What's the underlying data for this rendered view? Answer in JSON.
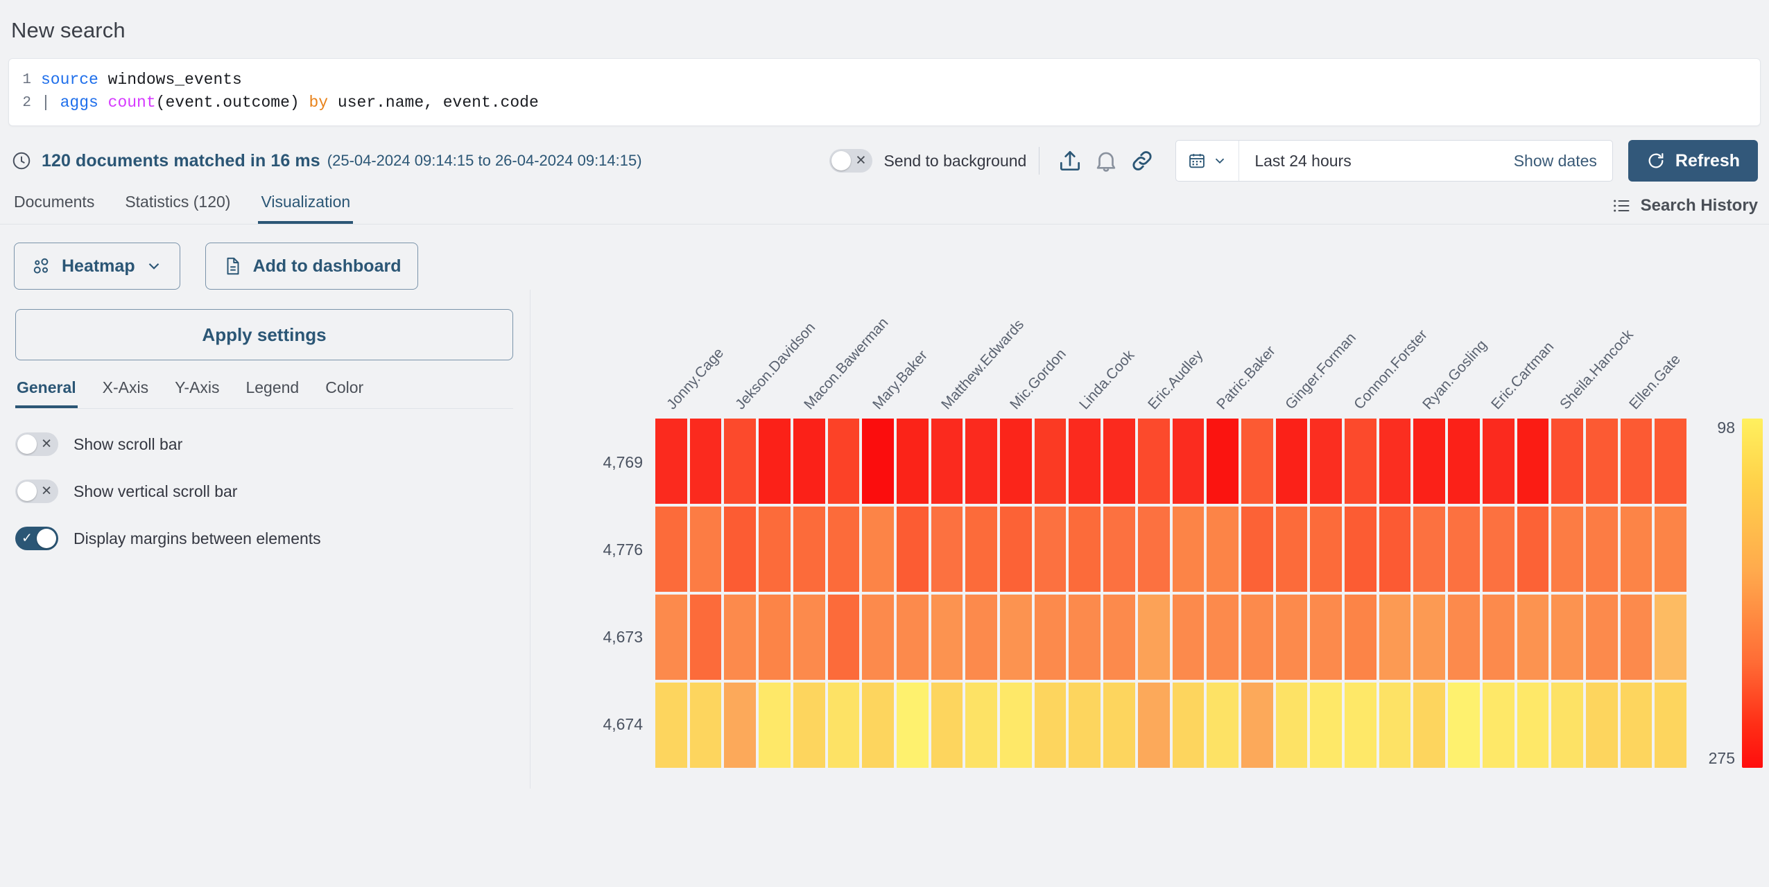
{
  "page": {
    "title": "New search"
  },
  "query": {
    "lines": [
      {
        "number": "1",
        "pipe": "",
        "tokens": [
          {
            "t": "source",
            "c": "kw"
          },
          {
            "t": " windows_events",
            "c": "txt"
          }
        ]
      },
      {
        "number": "2",
        "pipe": "|",
        "tokens": [
          {
            "t": " aggs ",
            "c": "kw"
          },
          {
            "t": "count",
            "c": "fn"
          },
          {
            "t": "(event.outcome) ",
            "c": "txt"
          },
          {
            "t": "by",
            "c": "op"
          },
          {
            "t": " user.name, event.code",
            "c": "txt"
          }
        ]
      }
    ]
  },
  "status": {
    "clock_icon": "clock-icon",
    "hits": "120 documents matched in 16 ms",
    "range": "(25-04-2024 09:14:15 to 26-04-2024 09:14:15)",
    "send_to_background": "Send to background",
    "send_to_background_state": "off",
    "export_icon": "export-icon",
    "alert_icon": "bell-icon",
    "link_icon": "link-icon",
    "calendar_icon": "calendar-icon",
    "chevron_icon": "chevron-down-icon",
    "date_range": "Last 24 hours",
    "show_dates": "Show dates",
    "refresh": "Refresh",
    "refresh_icon": "refresh-icon"
  },
  "tabs": {
    "items": [
      {
        "label": "Documents",
        "active": false
      },
      {
        "label": "Statistics (120)",
        "active": false
      },
      {
        "label": "Visualization",
        "active": true
      }
    ],
    "search_history": "Search History",
    "search_history_icon": "list-icon"
  },
  "viz_toolbar": {
    "chart_type": "Heatmap",
    "chart_type_icon": "heatmap-icon",
    "chart_type_chevron": "chevron-down-icon",
    "add_to_dashboard": "Add to dashboard",
    "add_to_dashboard_icon": "document-icon"
  },
  "settings": {
    "apply": "Apply settings",
    "tabs": [
      {
        "label": "General",
        "active": true
      },
      {
        "label": "X-Axis",
        "active": false
      },
      {
        "label": "Y-Axis",
        "active": false
      },
      {
        "label": "Legend",
        "active": false
      },
      {
        "label": "Color",
        "active": false
      }
    ],
    "options": [
      {
        "label": "Show scroll bar",
        "state": "off"
      },
      {
        "label": "Show vertical scroll bar",
        "state": "off"
      },
      {
        "label": "Display margins between elements",
        "state": "on"
      }
    ]
  },
  "chart_data": {
    "type": "heatmap",
    "title": "",
    "xlabel": "user.name",
    "ylabel": "event.code",
    "legend_position": "right",
    "legend_min": "98",
    "legend_max": "275",
    "value_range": [
      98,
      275
    ],
    "color_scale": [
      "#FFF05E",
      "#FFD24A",
      "#FFA94D",
      "#FF6B35",
      "#FF2D16",
      "#FF0D0D"
    ],
    "categories": [
      "Jonny.Cage",
      "Jekson.Davidson",
      "Macon.Bawerman",
      "Mary.Baker",
      "Matthew.Edwards",
      "Mic.Gordon",
      "Linda.Cook",
      "Eric.Audley",
      "Patric.Baker",
      "Ginger.Forman",
      "Connon.Forster",
      "Ryan.Gosling",
      "Eric.Cartman",
      "Sheila.Hancock",
      "Ellen.Gate"
    ],
    "rows": [
      "4,769",
      "4,776",
      "4,673",
      "4,674"
    ],
    "cell_colors": [
      [
        "#FB2A1E",
        "#FB2A1E",
        "#FC4A2C",
        "#FB2118",
        "#FB2118",
        "#FC4227",
        "#FB0D0D",
        "#FB2318",
        "#FB2A1E",
        "#FB2A1E",
        "#FB251A",
        "#FB3A23",
        "#FB2A1E",
        "#FB2A1E",
        "#FC4A2C",
        "#FB2C1F",
        "#FB1410",
        "#FC5A33",
        "#FB2118",
        "#FB2E20",
        "#FC4A2C",
        "#FB2E20",
        "#FB2118",
        "#FB2118",
        "#FB2A1E",
        "#FB1C14",
        "#FC4F2E",
        "#FC5A33",
        "#FC5A33",
        "#FC5A33"
      ],
      [
        "#FC6B3A",
        "#FC7C44",
        "#FC5C33",
        "#FC6B3A",
        "#FC6B3A",
        "#FC6B3A",
        "#FC8447",
        "#FC5C33",
        "#FC7140",
        "#FC6B3A",
        "#FC6236",
        "#FC7140",
        "#FC6B3A",
        "#FC7140",
        "#FC7140",
        "#FC8447",
        "#FC8447",
        "#FC6236",
        "#FC6B3A",
        "#FC6B3A",
        "#FC5C33",
        "#FC5A33",
        "#FC7140",
        "#FC7140",
        "#FC7140",
        "#FC6236",
        "#FC7C44",
        "#FC7C44",
        "#FC8447",
        "#FC8447"
      ],
      [
        "#FC8A4C",
        "#FC6B3A",
        "#FC8A4C",
        "#FC8447",
        "#FC8A4C",
        "#FC6B3A",
        "#FC8A4C",
        "#FC8A4C",
        "#FC9350",
        "#FC8A4C",
        "#FC9350",
        "#FC8A4C",
        "#FC8A4C",
        "#FC8A4C",
        "#FCA257",
        "#FC8A4C",
        "#FC8A4C",
        "#FC8A4C",
        "#FC8A4C",
        "#FC8A4C",
        "#FC8447",
        "#FC9A53",
        "#FC9A53",
        "#FC8A4C",
        "#FC8A4C",
        "#FC9350",
        "#FC9350",
        "#FC8A4C",
        "#FC8A4C",
        "#FDBB62"
      ],
      [
        "#FDD55E",
        "#FDD55E",
        "#FCA95A",
        "#FEE868",
        "#FDD55E",
        "#FDE265",
        "#FDD55E",
        "#FEF16E",
        "#FDD55E",
        "#FDE265",
        "#FEE868",
        "#FDD55E",
        "#FDD55E",
        "#FDD55E",
        "#FCA95A",
        "#FDD55E",
        "#FDE265",
        "#FCA95A",
        "#FDE265",
        "#FEE868",
        "#FEE868",
        "#FDE265",
        "#FDD55E",
        "#FEF16E",
        "#FEE868",
        "#FEE868",
        "#FDE265",
        "#FDD55E",
        "#FDD55E",
        "#FDD55E"
      ]
    ]
  }
}
